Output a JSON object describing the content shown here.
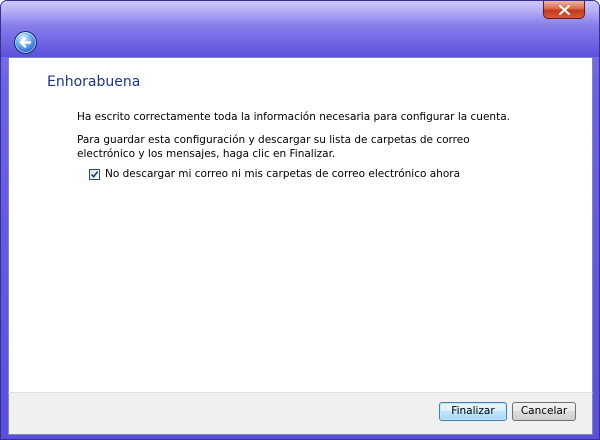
{
  "window": {
    "close_icon": "close-icon",
    "back_icon": "back-arrow-icon"
  },
  "page": {
    "title": "Enhorabuena",
    "line1": "Ha escrito correctamente toda la información necesaria para configurar la cuenta.",
    "line2": "Para guardar esta configuración y descargar su lista de carpetas de correo electrónico y los mensajes, haga clic en Finalizar.",
    "checkbox": {
      "label": "No descargar mi correo ni mis carpetas de correo electrónico ahora",
      "checked": true
    }
  },
  "footer": {
    "finish_label": "Finalizar",
    "cancel_label": "Cancelar"
  }
}
